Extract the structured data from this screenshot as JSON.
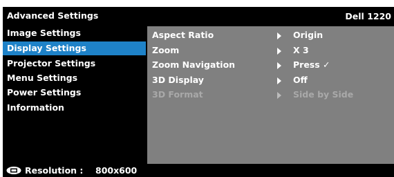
{
  "header": {
    "title": "Advanced Settings",
    "model": "Dell 1220"
  },
  "sidebar": {
    "items": [
      {
        "label": "Image Settings"
      },
      {
        "label": "Display Settings"
      },
      {
        "label": "Projector Settings"
      },
      {
        "label": "Menu Settings"
      },
      {
        "label": "Power Settings"
      },
      {
        "label": "Information"
      }
    ],
    "selected": "Display Settings"
  },
  "panel": {
    "rows": [
      {
        "label": "Aspect Ratio",
        "value": "Origin",
        "enabled": true
      },
      {
        "label": "Zoom",
        "value": "X 3",
        "enabled": true
      },
      {
        "label": "Zoom Navigation",
        "value": "Press ✓",
        "enabled": true
      },
      {
        "label": "3D Display",
        "value": "Off",
        "enabled": true
      },
      {
        "label": "3D Format",
        "value": "Side by Side",
        "enabled": false
      }
    ]
  },
  "footer": {
    "icon": "monitor-icon",
    "resolution_label": "Resolution :",
    "resolution_value": "800x600"
  },
  "colors": {
    "background": "#000000",
    "selection": "#1e82c8",
    "panel": "#808080",
    "text": "#ffffff",
    "disabled_text": "#a9a9a9"
  }
}
